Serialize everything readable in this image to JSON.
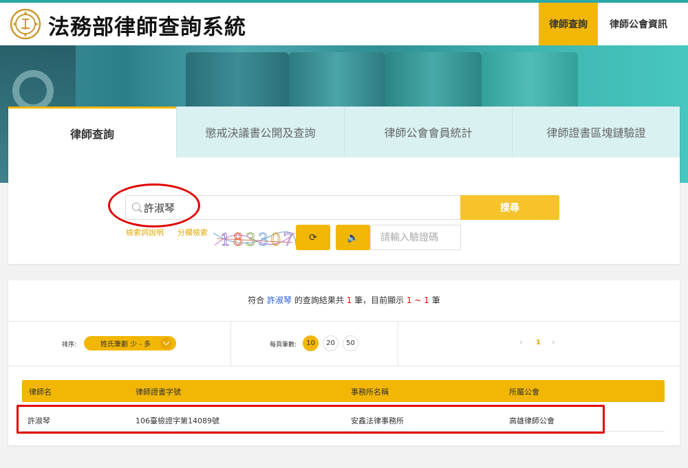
{
  "header": {
    "title": "法務部律師查詢系統",
    "nav": [
      "律師查詢",
      "律師公會資訊"
    ]
  },
  "tabs": [
    "律師查詢",
    "懲戒決議書公開及查詢",
    "律師公會會員統計",
    "律師證書區塊鏈驗證"
  ],
  "search": {
    "value": "許淑琴",
    "button_label": "搜尋",
    "help_link": "檢索詞說明",
    "field_search_link": "分欄檢索",
    "captcha_text": "183307",
    "captcha_placeholder": "請輸入驗證碼"
  },
  "results": {
    "summary_prefix": "符合 ",
    "query": "許淑琴",
    "summary_mid": " 的查詢結果共 ",
    "total": "1",
    "summary_mid2": " 筆，目前顯示 ",
    "range": "1 ~ 1",
    "summary_suffix": " 筆",
    "sort_label": "排序:",
    "sort_value": "姓氏筆劃 少 - 多",
    "per_page_label": "每頁筆數:",
    "per_page_options": [
      "10",
      "20",
      "50"
    ],
    "current_page": "1",
    "columns": [
      "律師名",
      "律師證書字號",
      "事務所名稱",
      "所屬公會"
    ],
    "rows": [
      {
        "name": "許淑琴",
        "cert": "106臺檢證字第14089號",
        "office": "安鑫法律事務所",
        "guild": "高雄律師公會"
      }
    ]
  },
  "colors": {
    "accent": "#f2b705",
    "teal": "#2aa9a6",
    "highlight_red": "#e00000",
    "query_blue": "#2a5bd7"
  }
}
